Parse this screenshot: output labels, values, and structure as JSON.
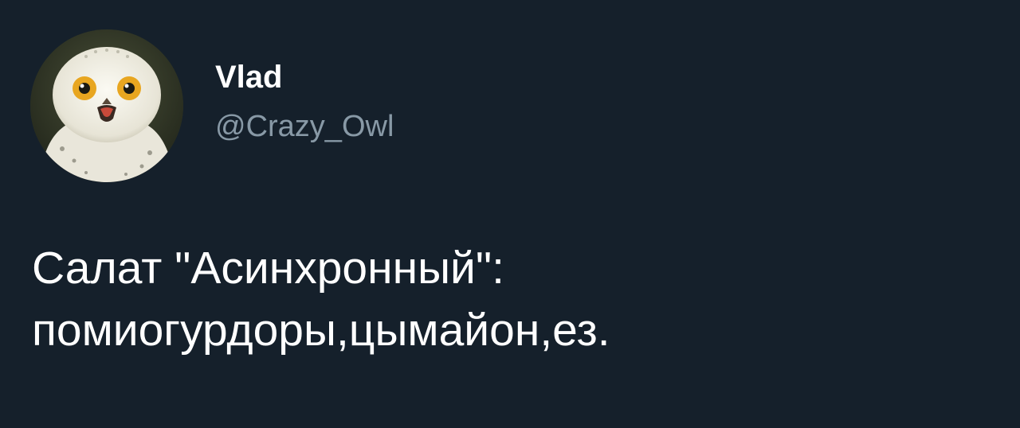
{
  "author": {
    "display_name": "Vlad",
    "handle": "@Crazy_Owl",
    "avatar_icon": "snowy-owl-avatar"
  },
  "tweet": {
    "lines": [
      "Салат \"Асинхронный\":",
      "помиогурдоры,цымайон,ез."
    ]
  },
  "colors": {
    "background": "#15202b",
    "text": "#ffffff",
    "secondary_text": "#8899a6"
  }
}
